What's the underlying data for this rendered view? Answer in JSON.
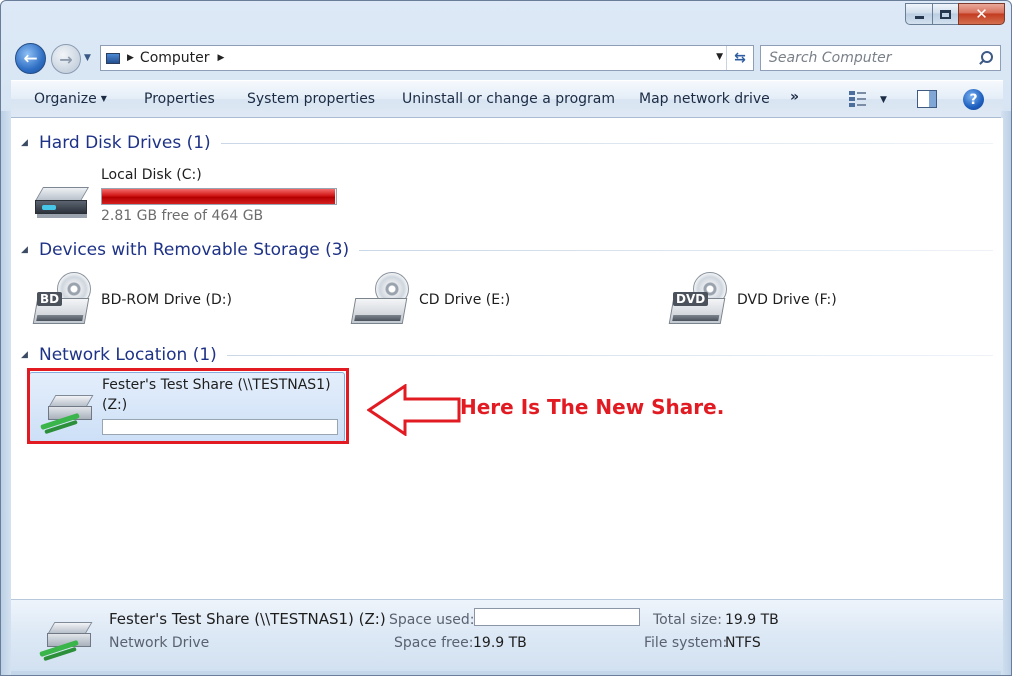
{
  "window": {
    "caption": {
      "minimize": "minimize",
      "maximize": "maximize",
      "close": "✕"
    }
  },
  "nav": {
    "back": "←",
    "forward": "→",
    "address": {
      "crumb": "Computer"
    },
    "search_placeholder": "Search Computer"
  },
  "toolbar": {
    "organize": "Organize",
    "properties": "Properties",
    "system_properties": "System properties",
    "uninstall": "Uninstall or change a program",
    "map_drive": "Map network drive",
    "more": "»",
    "help": "?"
  },
  "groups": {
    "hard_disks": {
      "title": "Hard Disk Drives (1)"
    },
    "removable": {
      "title": "Devices with Removable Storage (3)"
    },
    "network": {
      "title": "Network Location (1)"
    }
  },
  "drives": {
    "local_c": {
      "label": "Local Disk (C:)",
      "free": "2.81 GB free of 464 GB",
      "used_fraction": 0.994
    },
    "bd": {
      "label": "BD-ROM Drive (D:)",
      "tag": "BD"
    },
    "cd": {
      "label": "CD Drive (E:)"
    },
    "dvd": {
      "label": "DVD Drive (F:)",
      "tag": "DVD"
    },
    "net_z": {
      "label_line1": "Fester's Test Share (\\\\TESTNAS1)",
      "label_line2": "(Z:)",
      "used_fraction": 0.0
    }
  },
  "annotation": {
    "text": "Here Is The New Share.",
    "color": "#e21b23"
  },
  "details": {
    "name": "Fester's Test Share (\\\\TESTNAS1) (Z:)",
    "type": "Network Drive",
    "space_used_label": "Space used:",
    "space_free_label": "Space free:",
    "space_free_value": "19.9 TB",
    "total_size_label": "Total size:",
    "total_size_value": "19.9 TB",
    "file_system_label": "File system:",
    "file_system_value": "NTFS"
  },
  "colors": {
    "group_title": "#1e3287",
    "usage_bar": "#d11616",
    "selection": "#cde0f7"
  }
}
